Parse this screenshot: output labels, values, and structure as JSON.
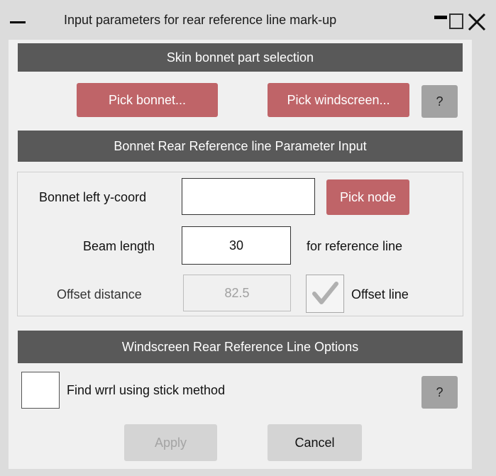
{
  "window": {
    "title": "Input parameters for rear reference line mark-up"
  },
  "skin_section": {
    "header": "Skin bonnet part selection",
    "pick_bonnet_label": "Pick bonnet...",
    "pick_windscreen_label": "Pick windscreen...",
    "help_label": "?"
  },
  "bonnet_section": {
    "header": "Bonnet Rear Reference line Parameter Input",
    "left_y_label": "Bonnet left y-coord",
    "left_y_value": "",
    "pick_node_label": "Pick node",
    "beam_length_label": "Beam length",
    "beam_length_value": "30",
    "for_reference_label": "for reference line",
    "offset_distance_label": "Offset distance",
    "offset_distance_value": "82.5",
    "offset_line_label": "Offset line",
    "offset_line_checked": true
  },
  "windscreen_section": {
    "header": "Windscreen Rear Reference Line Options",
    "stick_method_label": "Find wrrl using stick method",
    "stick_method_checked": false,
    "help_label": "?"
  },
  "footer": {
    "apply_label": "Apply",
    "cancel_label": "Cancel"
  },
  "colors": {
    "header_bg": "#595959",
    "pick_button_bg": "#bf6468",
    "help_button_bg": "#a2a2a2",
    "neutral_button_bg": "#d4d4d4"
  }
}
